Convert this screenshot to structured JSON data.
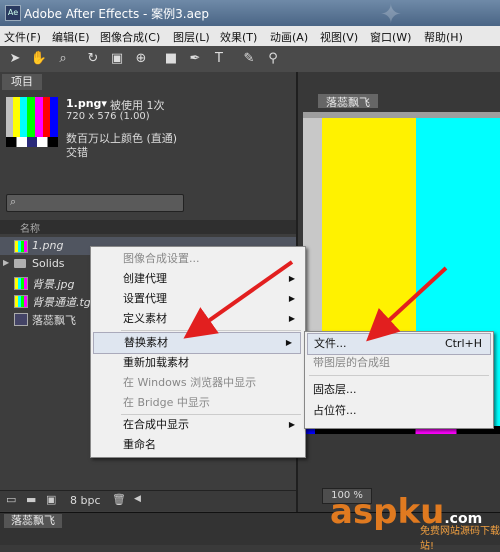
{
  "window": {
    "title": "Adobe After Effects - 案例3.aep",
    "app_icon": "Ae"
  },
  "menubar": [
    {
      "label": "文件(F)"
    },
    {
      "label": "编辑(E)"
    },
    {
      "label": "图像合成(C)"
    },
    {
      "label": "图层(L)"
    },
    {
      "label": "效果(T)"
    },
    {
      "label": "动画(A)"
    },
    {
      "label": "视图(V)"
    },
    {
      "label": "窗口(W)"
    },
    {
      "label": "帮助(H)"
    }
  ],
  "toolbar_icons": [
    "arrow-tool-icon",
    "hand-tool-icon",
    "zoom-tool-icon",
    "rotate-tool-icon",
    "camera-tool-icon",
    "pan-behind-icon",
    "rectangle-tool-icon",
    "pen-tool-icon",
    "text-tool-icon",
    "brush-tool-icon",
    "clone-tool-icon",
    "eraser-tool-icon"
  ],
  "project": {
    "tab_label": "项目",
    "selected_name": "1.png▾",
    "used": "被使用 1次",
    "dimensions": "720 x 576 (1.00)",
    "color_depth": "数百万以上颜色 (直通)",
    "interlace": "交错",
    "column_name": "名称",
    "items": [
      {
        "label": "1.png",
        "type": "file"
      },
      {
        "label": "Solids",
        "type": "folder"
      },
      {
        "label": "背景.jpg",
        "type": "file"
      },
      {
        "label": "背景通道.tga",
        "type": "file"
      },
      {
        "label": "落蕊飘飞",
        "type": "comp"
      }
    ],
    "bpc": "8 bpc"
  },
  "comp": {
    "tab_label": "落蕊飘飞",
    "zoom": "100 %"
  },
  "timeline": {
    "tab_label": "落蕊飘飞"
  },
  "context_menu": [
    {
      "label": "图像合成设置...",
      "enabled": false,
      "submenu": false
    },
    {
      "label": "创建代理",
      "enabled": true,
      "submenu": true
    },
    {
      "label": "设置代理",
      "enabled": true,
      "submenu": true
    },
    {
      "label": "定义素材",
      "enabled": true,
      "submenu": true
    },
    {
      "label": "替换素材",
      "enabled": true,
      "submenu": true,
      "highlighted": true
    },
    {
      "label": "重新加载素材",
      "enabled": true,
      "submenu": false
    },
    {
      "label": "在 Windows 浏览器中显示",
      "enabled": false,
      "submenu": false
    },
    {
      "label": "在 Bridge 中显示",
      "enabled": false,
      "submenu": false
    },
    {
      "label": "在合成中显示",
      "enabled": true,
      "submenu": true
    },
    {
      "label": "重命名",
      "enabled": true,
      "submenu": false
    }
  ],
  "submenu": [
    {
      "label": "文件...",
      "shortcut": "Ctrl+H",
      "enabled": true
    },
    {
      "label": "带图层的合成组",
      "shortcut": "",
      "enabled": false
    },
    {
      "label": "固态层...",
      "shortcut": "",
      "enabled": true
    },
    {
      "label": "占位符...",
      "shortcut": "",
      "enabled": true
    }
  ],
  "watermark": {
    "brand": "aspku",
    "suffix": ".com",
    "tagline": "免费网站源码下载站!"
  }
}
